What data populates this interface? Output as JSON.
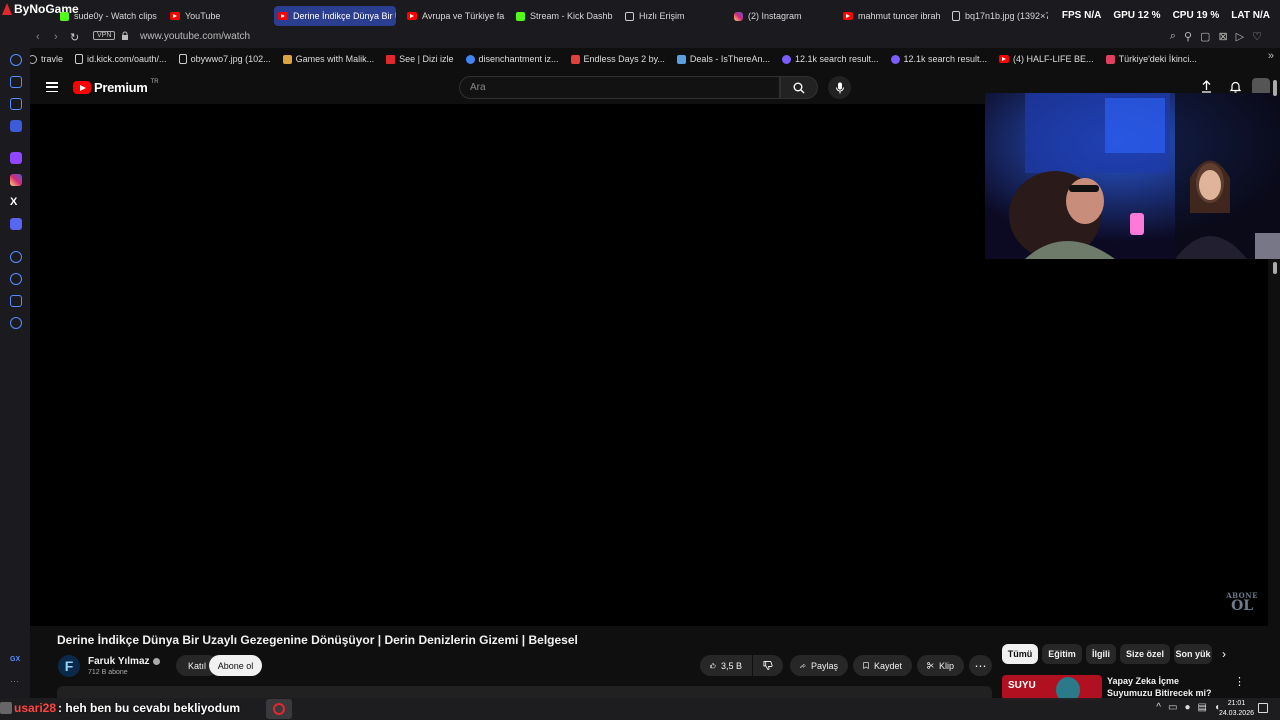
{
  "overlay": {
    "brand": "ByNoGame",
    "fps_label": "FPS",
    "fps_value": "N/A",
    "gpu_label": "GPU",
    "gpu_value": "12 %",
    "cpu_label": "CPU",
    "cpu_value": "19 %",
    "lat_label": "LAT",
    "lat_value": "N/A"
  },
  "tabs": [
    {
      "label": "sude0y - Watch clips",
      "icon": "kick-icon"
    },
    {
      "label": "YouTube",
      "icon": "youtube-icon"
    },
    {
      "label": "Derine İndikçe Dünya Bir U",
      "icon": "youtube-icon",
      "active": true
    },
    {
      "label": "Avrupa ve Türkiye fa",
      "icon": "youtube-icon"
    },
    {
      "label": "Stream - Kick Dashb",
      "icon": "kick-icon"
    },
    {
      "label": "Hızlı Erişim",
      "icon": "grid-icon"
    },
    {
      "label": "(2) Instagram",
      "icon": "instagram-icon"
    },
    {
      "label": "mahmut tuncer ibrah",
      "icon": "youtube-icon"
    },
    {
      "label": "bq17n1b.jpg (1392×7",
      "icon": "document-icon"
    }
  ],
  "addressbar": {
    "vpn": "VPN",
    "url": "www.youtube.com/watch"
  },
  "bookmarks": [
    {
      "label": "travle",
      "color": "#bbbbbb"
    },
    {
      "label": "id.kick.com/oauth/...",
      "color": "#dddddd"
    },
    {
      "label": "obywwo7.jpg (102...",
      "color": "#dddddd"
    },
    {
      "label": "Games with Malik...",
      "color": "#d9a441"
    },
    {
      "label": "See | Dizi izle",
      "color": "#e0282e"
    },
    {
      "label": "disenchantment iz...",
      "color": "#4285f4"
    },
    {
      "label": "Endless Days 2 by...",
      "color": "#e04040"
    },
    {
      "label": "Deals - IsThereAn...",
      "color": "#5aa0e0"
    },
    {
      "label": "12.1k search result...",
      "color": "#7b5cff"
    },
    {
      "label": "12.1k search result...",
      "color": "#7b5cff"
    },
    {
      "label": "(4) HALF-LIFE BE...",
      "color": "#ff0000"
    },
    {
      "label": "Türkiye'deki İkinci...",
      "color": "#e04060"
    }
  ],
  "youtube": {
    "logo_text": "Premium",
    "region": "TR",
    "search_placeholder": "Ara"
  },
  "video": {
    "watermark_top": "ABONE",
    "watermark_bottom": "OL",
    "title": "Derine İndikçe Dünya Bir Uzaylı Gezegenine Dönüşüyor | Derin Denizlerin Gizemi | Belgesel",
    "channel_initial": "F",
    "channel_name": "Faruk Yılmaz",
    "subscribers": "712 B abone",
    "join_label": "Katıl",
    "subscribe_label": "Abone ol",
    "likes": "3,5 B",
    "share_label": "Paylaş",
    "save_label": "Kaydet",
    "clip_label": "Klip"
  },
  "chips": [
    "Tümü",
    "Eğitim",
    "İlgili",
    "Size özel",
    "Son yük"
  ],
  "recommendation": {
    "title": "Yapay Zeka İçme Suyumuzu Bitirecek mi?",
    "thumb_text": "SUYU"
  },
  "chat": {
    "user": "usari28",
    "message": ": heh ben bu cevabı bekliyodum"
  },
  "taskbar": {
    "time": "21:01",
    "date": "24.03.2026"
  }
}
